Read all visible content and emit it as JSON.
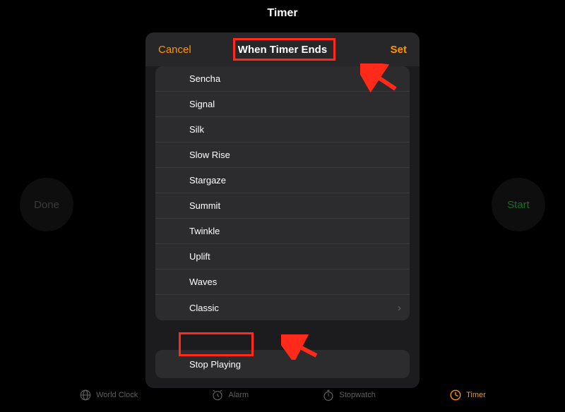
{
  "page": {
    "title": "Timer"
  },
  "buttons": {
    "done": "Done",
    "start": "Start"
  },
  "modal": {
    "cancel": "Cancel",
    "title": "When Timer Ends",
    "set": "Set",
    "stop_playing": "Stop Playing"
  },
  "sounds": [
    {
      "label": "Sencha",
      "disclosure": false
    },
    {
      "label": "Signal",
      "disclosure": false
    },
    {
      "label": "Silk",
      "disclosure": false
    },
    {
      "label": "Slow Rise",
      "disclosure": false
    },
    {
      "label": "Stargaze",
      "disclosure": false
    },
    {
      "label": "Summit",
      "disclosure": false
    },
    {
      "label": "Twinkle",
      "disclosure": false
    },
    {
      "label": "Uplift",
      "disclosure": false
    },
    {
      "label": "Waves",
      "disclosure": false
    },
    {
      "label": "Classic",
      "disclosure": true
    }
  ],
  "tabs": [
    {
      "label": "World Clock",
      "icon": "globe-icon",
      "active": false
    },
    {
      "label": "Alarm",
      "icon": "alarm-icon",
      "active": false
    },
    {
      "label": "Stopwatch",
      "icon": "stopwatch-icon",
      "active": false
    },
    {
      "label": "Timer",
      "icon": "timer-icon",
      "active": true
    }
  ]
}
